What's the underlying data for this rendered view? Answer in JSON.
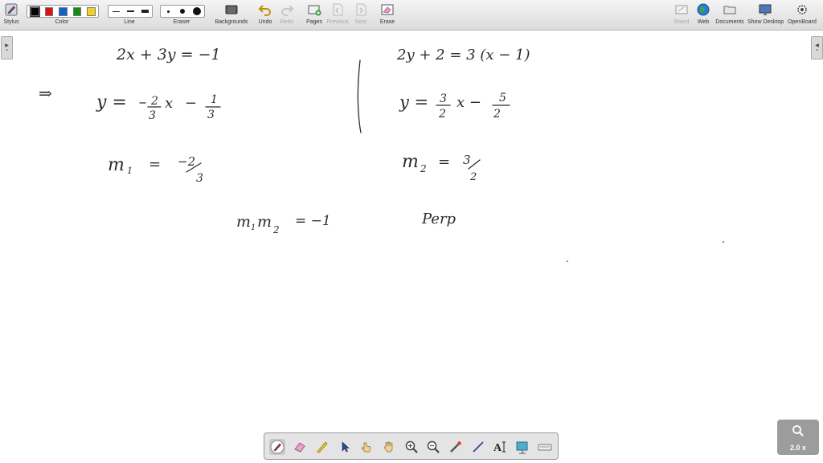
{
  "toolbar": {
    "stylus": "Stylus",
    "color": "Color",
    "line": "Line",
    "eraser": "Eraser",
    "backgrounds": "Backgrounds",
    "undo": "Undo",
    "redo": "Redo",
    "pages": "Pages",
    "previous": "Previous",
    "next": "Next",
    "erase": "Erase",
    "board": "Board",
    "web": "Web",
    "documents": "Documents",
    "show_desktop": "Show Desktop",
    "openboard": "OpenBoard",
    "colors": [
      "#000000",
      "#e01010",
      "#1060d0",
      "#109010",
      "#f0d020"
    ]
  },
  "board": {
    "eq1": "2x + 3y = −1",
    "implies": "⇒",
    "eq2_y": "y =",
    "eq2_num1": "2",
    "eq2_den1": "3",
    "eq2_minus": "−",
    "eq2_x": "x",
    "eq2_num2": "1",
    "eq2_den2": "3",
    "m1": "m",
    "m1_sub": "1",
    "m1_eq": "=",
    "m1_val_num": "−2",
    "m1_val_den": "3",
    "right_eq1": "2y + 2 = 3 (x − 1)",
    "right_y": "y =",
    "right_num1": "3",
    "right_den1": "2",
    "right_x": "x −",
    "right_num2": "5",
    "right_den2": "2",
    "m2": "m",
    "m2_sub": "2",
    "m2_eq": "=",
    "m2_val_num": "3",
    "m2_val_den": "2",
    "product": "m",
    "product_sub1": "1",
    "product_m2": "m",
    "product_sub2": "2",
    "product_eq": "= −1",
    "perp": "Perp"
  },
  "zoom": {
    "value": "2.0 x"
  }
}
